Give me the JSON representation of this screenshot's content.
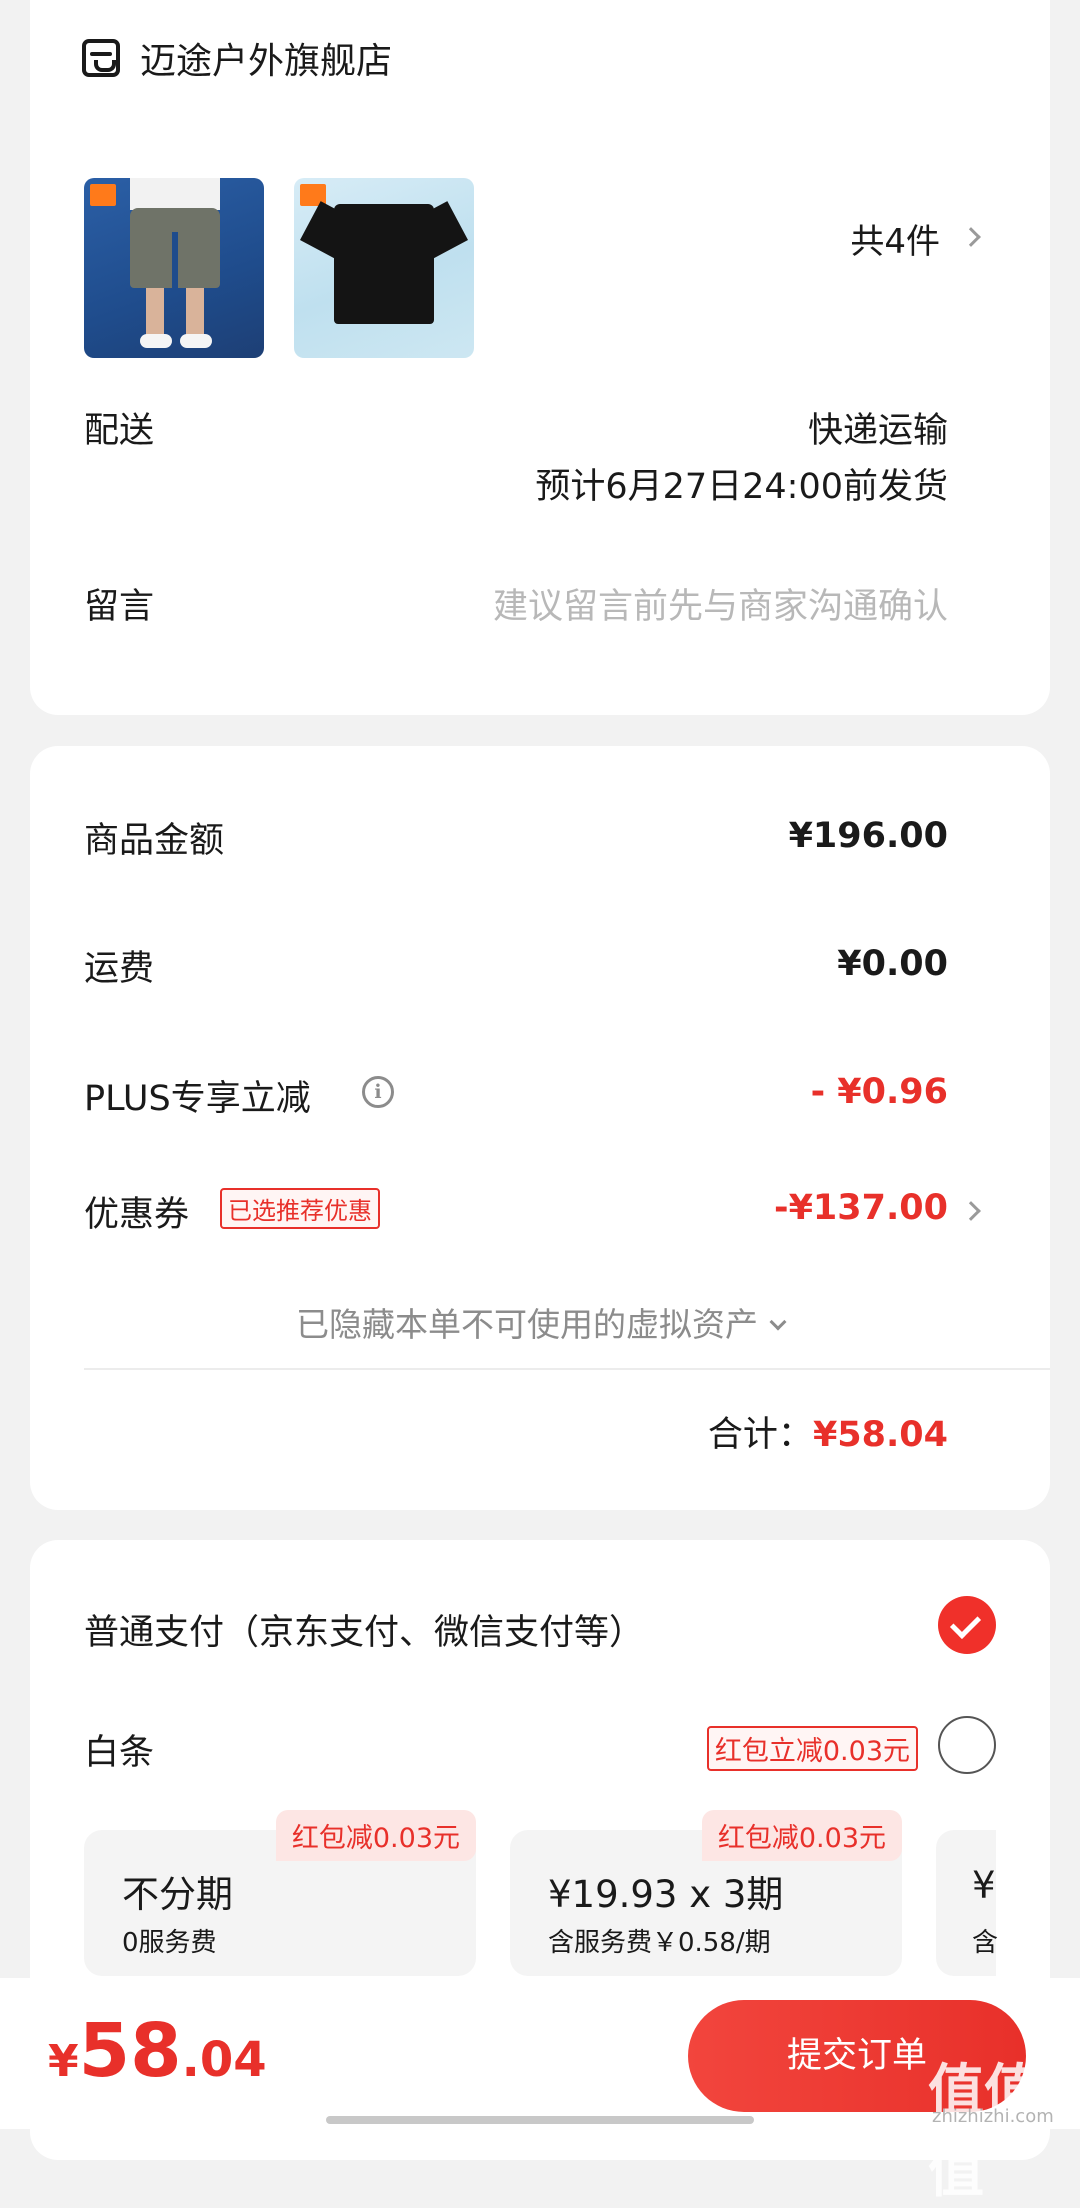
{
  "shop": {
    "name": "迈途户外旗舰店",
    "product_count": "共4件",
    "delivery_label": "配送",
    "delivery_method": "快递运输",
    "delivery_eta": "预计6月27日24:00前发货",
    "message_label": "留言",
    "message_placeholder": "建议留言前先与商家沟通确认"
  },
  "amounts": {
    "goods_label": "商品金额",
    "goods_value": "¥196.00",
    "shipping_label": "运费",
    "shipping_value": "¥0.00",
    "plus_label": "PLUS专享立减",
    "plus_value": "- ¥0.96",
    "coupon_label": "优惠券",
    "coupon_tag": "已选推荐优惠",
    "coupon_value": "-¥137.00",
    "hidden_assets": "已隐藏本单不可使用的虚拟资产",
    "total_label": "合计：",
    "total_value": "¥58.04"
  },
  "payment": {
    "normal_label": "普通支付（京东支付、微信支付等）",
    "baitiao_label": "白条",
    "baitiao_tag": "红包立减0.03元",
    "installments": [
      {
        "badge": "红包减0.03元",
        "main": "不分期",
        "sub": "0服务费"
      },
      {
        "badge": "红包减0.03元",
        "main": "¥19.93 x 3期",
        "sub": "含服务费￥0.58/期"
      },
      {
        "main": "¥",
        "sub": "含"
      }
    ]
  },
  "bottom": {
    "price_symbol": "¥",
    "price_int": "58",
    "price_dec": ".04",
    "submit_label": "提交订单"
  },
  "watermark": {
    "text": "值值值",
    "url": "zhizhizhi.com"
  },
  "colors": {
    "accent": "#e8302a",
    "background": "#f2f2f2"
  }
}
